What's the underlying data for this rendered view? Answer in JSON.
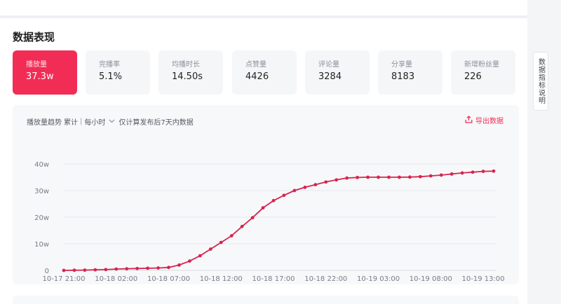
{
  "page": {
    "title": "数据表现"
  },
  "metrics": [
    {
      "label": "播放量",
      "value": "37.3w",
      "active": true
    },
    {
      "label": "完播率",
      "value": "5.1%"
    },
    {
      "label": "均播时长",
      "value": "14.50s"
    },
    {
      "label": "点赞量",
      "value": "4426"
    },
    {
      "label": "评论量",
      "value": "3284"
    },
    {
      "label": "分享量",
      "value": "8183"
    },
    {
      "label": "新增粉丝量",
      "value": "226"
    }
  ],
  "chart_header": {
    "title": "播放量趋势",
    "mode": "累计",
    "interval": "每小时",
    "note": "仅计算发布后7天内数据",
    "export_label": "导出数据"
  },
  "side_panel": {
    "label": "数据指标说明"
  },
  "colors": {
    "accent": "#f22d55",
    "line": "#d8244f"
  },
  "chart_data": {
    "type": "line",
    "y_ticks": [
      "0",
      "10w",
      "20w",
      "30w",
      "40w"
    ],
    "ylim": [
      0,
      40
    ],
    "x_tick_labels": [
      "10-17 21:00",
      "10-18 02:00",
      "10-18 07:00",
      "10-18 12:00",
      "10-18 17:00",
      "10-18 22:00",
      "10-19 03:00",
      "10-19 08:00",
      "10-19 13:00"
    ],
    "x_tick_index": [
      0,
      5,
      10,
      15,
      20,
      25,
      30,
      35,
      40
    ],
    "series": [
      {
        "values": [
          0,
          0.05,
          0.1,
          0.2,
          0.3,
          0.5,
          0.6,
          0.7,
          0.8,
          0.9,
          1.1,
          2,
          3.5,
          5.5,
          8,
          10.5,
          13,
          16.5,
          19.8,
          23.5,
          26.2,
          28.2,
          30,
          31.2,
          32.2,
          33.2,
          34,
          34.7,
          34.9,
          35,
          35,
          35,
          35,
          35.05,
          35.2,
          35.5,
          35.8,
          36.2,
          36.6,
          36.9,
          37.2,
          37.3
        ]
      }
    ]
  }
}
